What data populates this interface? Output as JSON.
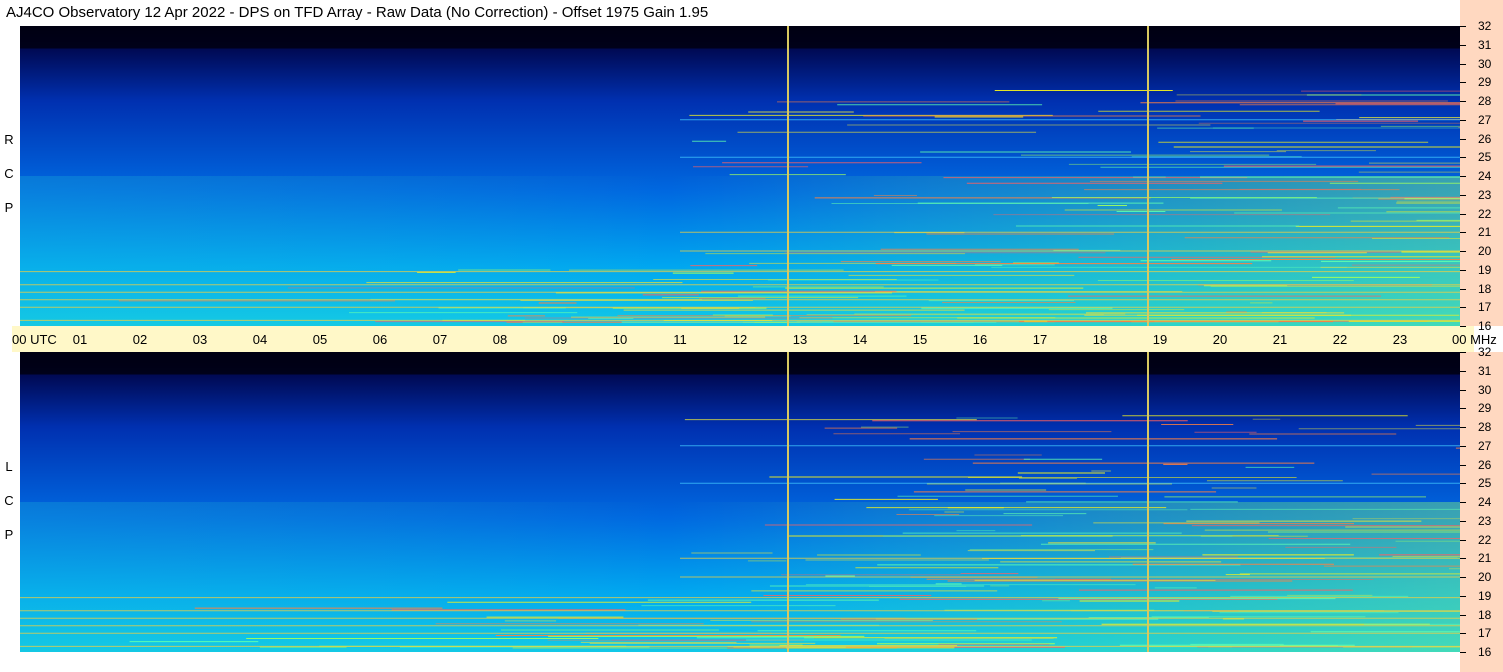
{
  "header": {
    "title": "AJ4CO Observatory  12 Apr 2022  -  DPS on TFD Array  -  Raw Data (No Correction)  -  Offset 1975  Gain 1.95"
  },
  "panels": [
    {
      "id": "rcp",
      "label_letters": [
        "R",
        "C",
        "P"
      ]
    },
    {
      "id": "lcp",
      "label_letters": [
        "L",
        "C",
        "P"
      ]
    }
  ],
  "colors": {
    "time_axis_bg": "#fff8c8",
    "freq_axis_bg": "#ffd8c0",
    "marker_line": "#d8c860"
  },
  "chart_data": {
    "type": "heatmap",
    "title": "AJ4CO Observatory  12 Apr 2022  -  DPS on TFD Array  -  Raw Data (No Correction)  -  Offset 1975  Gain 1.95",
    "x_tick_labels": [
      "00  UTC",
      "01",
      "02",
      "03",
      "04",
      "05",
      "06",
      "07",
      "08",
      "09",
      "10",
      "11",
      "12",
      "13",
      "14",
      "15",
      "16",
      "17",
      "18",
      "19",
      "20",
      "21",
      "22",
      "23",
      "00 MHz"
    ],
    "y_tick_labels": [
      "32",
      "31",
      "30",
      "29",
      "28",
      "27",
      "26",
      "25",
      "24",
      "23",
      "22",
      "21",
      "20",
      "19",
      "18",
      "17",
      "16"
    ],
    "x_unit": "UTC hour",
    "y_unit": "MHz",
    "xlim": [
      0,
      24
    ],
    "ylim": [
      16,
      32
    ],
    "marker_times_utc": [
      12.8,
      18.8
    ],
    "series": [
      {
        "name": "RCP"
      },
      {
        "name": "LCP"
      }
    ],
    "notable_lines_mhz": [
      16.3,
      17.0,
      17.4,
      17.8,
      18.2,
      18.9,
      20.0,
      21.0,
      25.0,
      27.0
    ]
  }
}
